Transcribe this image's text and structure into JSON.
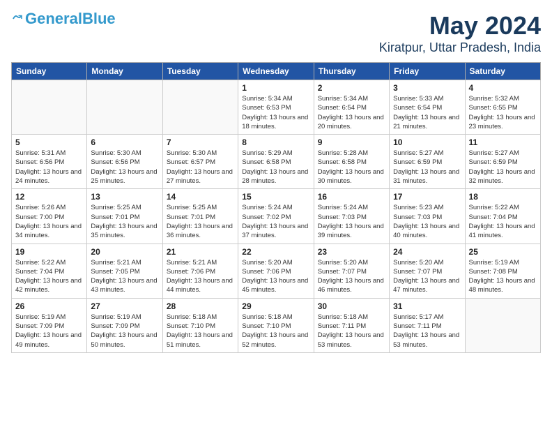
{
  "logo": {
    "general": "General",
    "blue": "Blue"
  },
  "header": {
    "month": "May 2024",
    "location": "Kiratpur, Uttar Pradesh, India"
  },
  "days_of_week": [
    "Sunday",
    "Monday",
    "Tuesday",
    "Wednesday",
    "Thursday",
    "Friday",
    "Saturday"
  ],
  "weeks": [
    [
      {
        "day": "",
        "info": ""
      },
      {
        "day": "",
        "info": ""
      },
      {
        "day": "",
        "info": ""
      },
      {
        "day": "1",
        "info": "Sunrise: 5:34 AM\nSunset: 6:53 PM\nDaylight: 13 hours\nand 18 minutes."
      },
      {
        "day": "2",
        "info": "Sunrise: 5:34 AM\nSunset: 6:54 PM\nDaylight: 13 hours\nand 20 minutes."
      },
      {
        "day": "3",
        "info": "Sunrise: 5:33 AM\nSunset: 6:54 PM\nDaylight: 13 hours\nand 21 minutes."
      },
      {
        "day": "4",
        "info": "Sunrise: 5:32 AM\nSunset: 6:55 PM\nDaylight: 13 hours\nand 23 minutes."
      }
    ],
    [
      {
        "day": "5",
        "info": "Sunrise: 5:31 AM\nSunset: 6:56 PM\nDaylight: 13 hours\nand 24 minutes."
      },
      {
        "day": "6",
        "info": "Sunrise: 5:30 AM\nSunset: 6:56 PM\nDaylight: 13 hours\nand 25 minutes."
      },
      {
        "day": "7",
        "info": "Sunrise: 5:30 AM\nSunset: 6:57 PM\nDaylight: 13 hours\nand 27 minutes."
      },
      {
        "day": "8",
        "info": "Sunrise: 5:29 AM\nSunset: 6:58 PM\nDaylight: 13 hours\nand 28 minutes."
      },
      {
        "day": "9",
        "info": "Sunrise: 5:28 AM\nSunset: 6:58 PM\nDaylight: 13 hours\nand 30 minutes."
      },
      {
        "day": "10",
        "info": "Sunrise: 5:27 AM\nSunset: 6:59 PM\nDaylight: 13 hours\nand 31 minutes."
      },
      {
        "day": "11",
        "info": "Sunrise: 5:27 AM\nSunset: 6:59 PM\nDaylight: 13 hours\nand 32 minutes."
      }
    ],
    [
      {
        "day": "12",
        "info": "Sunrise: 5:26 AM\nSunset: 7:00 PM\nDaylight: 13 hours\nand 34 minutes."
      },
      {
        "day": "13",
        "info": "Sunrise: 5:25 AM\nSunset: 7:01 PM\nDaylight: 13 hours\nand 35 minutes."
      },
      {
        "day": "14",
        "info": "Sunrise: 5:25 AM\nSunset: 7:01 PM\nDaylight: 13 hours\nand 36 minutes."
      },
      {
        "day": "15",
        "info": "Sunrise: 5:24 AM\nSunset: 7:02 PM\nDaylight: 13 hours\nand 37 minutes."
      },
      {
        "day": "16",
        "info": "Sunrise: 5:24 AM\nSunset: 7:03 PM\nDaylight: 13 hours\nand 39 minutes."
      },
      {
        "day": "17",
        "info": "Sunrise: 5:23 AM\nSunset: 7:03 PM\nDaylight: 13 hours\nand 40 minutes."
      },
      {
        "day": "18",
        "info": "Sunrise: 5:22 AM\nSunset: 7:04 PM\nDaylight: 13 hours\nand 41 minutes."
      }
    ],
    [
      {
        "day": "19",
        "info": "Sunrise: 5:22 AM\nSunset: 7:04 PM\nDaylight: 13 hours\nand 42 minutes."
      },
      {
        "day": "20",
        "info": "Sunrise: 5:21 AM\nSunset: 7:05 PM\nDaylight: 13 hours\nand 43 minutes."
      },
      {
        "day": "21",
        "info": "Sunrise: 5:21 AM\nSunset: 7:06 PM\nDaylight: 13 hours\nand 44 minutes."
      },
      {
        "day": "22",
        "info": "Sunrise: 5:20 AM\nSunset: 7:06 PM\nDaylight: 13 hours\nand 45 minutes."
      },
      {
        "day": "23",
        "info": "Sunrise: 5:20 AM\nSunset: 7:07 PM\nDaylight: 13 hours\nand 46 minutes."
      },
      {
        "day": "24",
        "info": "Sunrise: 5:20 AM\nSunset: 7:07 PM\nDaylight: 13 hours\nand 47 minutes."
      },
      {
        "day": "25",
        "info": "Sunrise: 5:19 AM\nSunset: 7:08 PM\nDaylight: 13 hours\nand 48 minutes."
      }
    ],
    [
      {
        "day": "26",
        "info": "Sunrise: 5:19 AM\nSunset: 7:09 PM\nDaylight: 13 hours\nand 49 minutes."
      },
      {
        "day": "27",
        "info": "Sunrise: 5:19 AM\nSunset: 7:09 PM\nDaylight: 13 hours\nand 50 minutes."
      },
      {
        "day": "28",
        "info": "Sunrise: 5:18 AM\nSunset: 7:10 PM\nDaylight: 13 hours\nand 51 minutes."
      },
      {
        "day": "29",
        "info": "Sunrise: 5:18 AM\nSunset: 7:10 PM\nDaylight: 13 hours\nand 52 minutes."
      },
      {
        "day": "30",
        "info": "Sunrise: 5:18 AM\nSunset: 7:11 PM\nDaylight: 13 hours\nand 53 minutes."
      },
      {
        "day": "31",
        "info": "Sunrise: 5:17 AM\nSunset: 7:11 PM\nDaylight: 13 hours\nand 53 minutes."
      },
      {
        "day": "",
        "info": ""
      }
    ]
  ]
}
